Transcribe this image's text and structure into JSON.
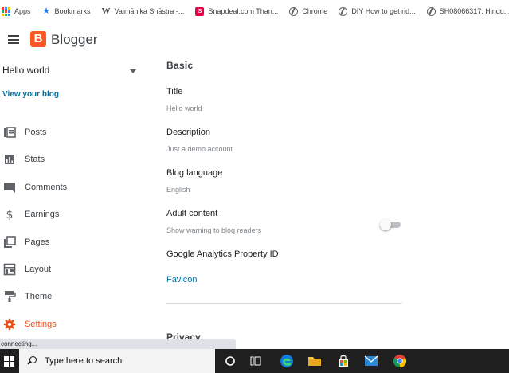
{
  "bookmarks": [
    {
      "label": "Apps",
      "icon": "apps-grid-icon"
    },
    {
      "label": "Bookmarks",
      "icon": "star-icon"
    },
    {
      "label": "Vaimānika Shāstra -...",
      "icon": "wikipedia-icon"
    },
    {
      "label": "Snapdeal.com Than...",
      "icon": "snapdeal-icon"
    },
    {
      "label": "Chrome",
      "icon": "globe-icon"
    },
    {
      "label": "DIY How to get rid...",
      "icon": "globe-icon"
    },
    {
      "label": "SH08066317: Hindu...",
      "icon": "globe-icon"
    }
  ],
  "header": {
    "brand": "Blogger",
    "logo_letter": "B"
  },
  "sidebar": {
    "blog_name": "Hello world",
    "view_blog": "View your blog",
    "items": [
      {
        "label": "Posts",
        "icon": "posts-icon"
      },
      {
        "label": "Stats",
        "icon": "stats-icon"
      },
      {
        "label": "Comments",
        "icon": "comments-icon"
      },
      {
        "label": "Earnings",
        "icon": "dollar-icon"
      },
      {
        "label": "Pages",
        "icon": "pages-icon"
      },
      {
        "label": "Layout",
        "icon": "layout-icon"
      },
      {
        "label": "Theme",
        "icon": "paint-roller-icon"
      },
      {
        "label": "Settings",
        "icon": "gear-icon",
        "active": true
      }
    ]
  },
  "settings": {
    "section_basic": "Basic",
    "title_label": "Title",
    "title_value": "Hello world",
    "description_label": "Description",
    "description_value": "Just a demo account",
    "language_label": "Blog language",
    "language_value": "English",
    "adult_label": "Adult content",
    "adult_value": "Show warning to blog readers",
    "adult_enabled": false,
    "analytics_label": "Google Analytics Property ID",
    "favicon_label": "Favicon",
    "section_privacy": "Privacy"
  },
  "status_text": "connecting...",
  "taskbar": {
    "search_placeholder": "Type here to search"
  },
  "colors": {
    "accent": "#e8501a",
    "link": "#0b6e99",
    "logo": "#ff5722"
  }
}
